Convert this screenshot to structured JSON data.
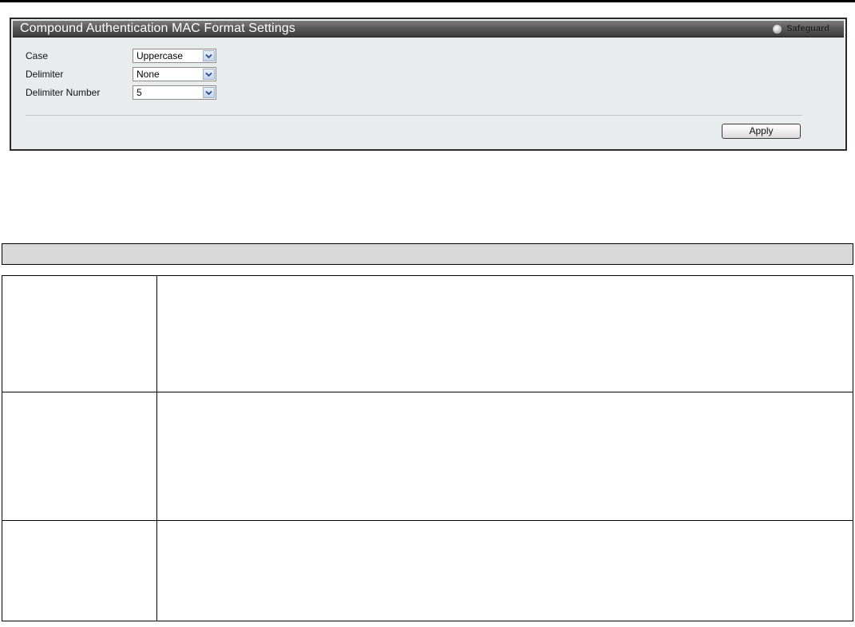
{
  "panel": {
    "title": "Compound Authentication MAC Format Settings",
    "safeguard_label": "Safeguard"
  },
  "form": {
    "case_label": "Case",
    "case_value": "Uppercase",
    "delimiter_label": "Delimiter",
    "delimiter_value": "None",
    "delimiter_number_label": "Delimiter Number",
    "delimiter_number_value": "5",
    "apply_label": "Apply"
  },
  "colors": {
    "header_dark": "#3b3b3b",
    "panel_bg": "#e8ecec",
    "table_header_bg": "#d9d9d9"
  },
  "icons": {
    "dropdown": "chevron-down-icon",
    "safeguard": "safeguard-indicator-icon"
  }
}
